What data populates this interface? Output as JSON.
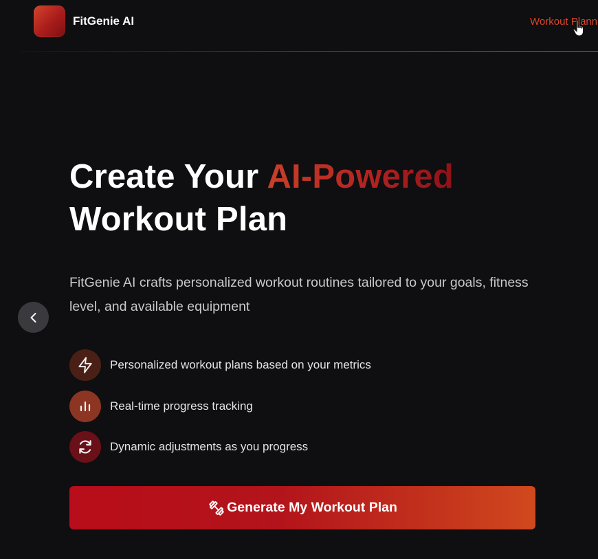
{
  "header": {
    "brand": "FitGenie AI",
    "nav_link": "Workout Planner"
  },
  "hero": {
    "title_part1": "Create Your ",
    "title_accent": "AI-Powered",
    "title_part2": "Workout Plan",
    "subtitle": "FitGenie AI crafts personalized workout routines tailored to your goals, fitness level, and available equipment"
  },
  "features": [
    {
      "icon": "lightning-icon",
      "label": "Personalized workout plans based on your metrics"
    },
    {
      "icon": "bar-chart-icon",
      "label": "Real-time progress tracking"
    },
    {
      "icon": "refresh-icon",
      "label": "Dynamic adjustments as you progress"
    }
  ],
  "cta": {
    "icon": "dumbbell-icon",
    "label": "Generate My Workout Plan"
  },
  "colors": {
    "background": "#0f0e10",
    "accent": "#d9452a",
    "cta_start": "#b80d1a",
    "cta_end": "#d1491e"
  }
}
